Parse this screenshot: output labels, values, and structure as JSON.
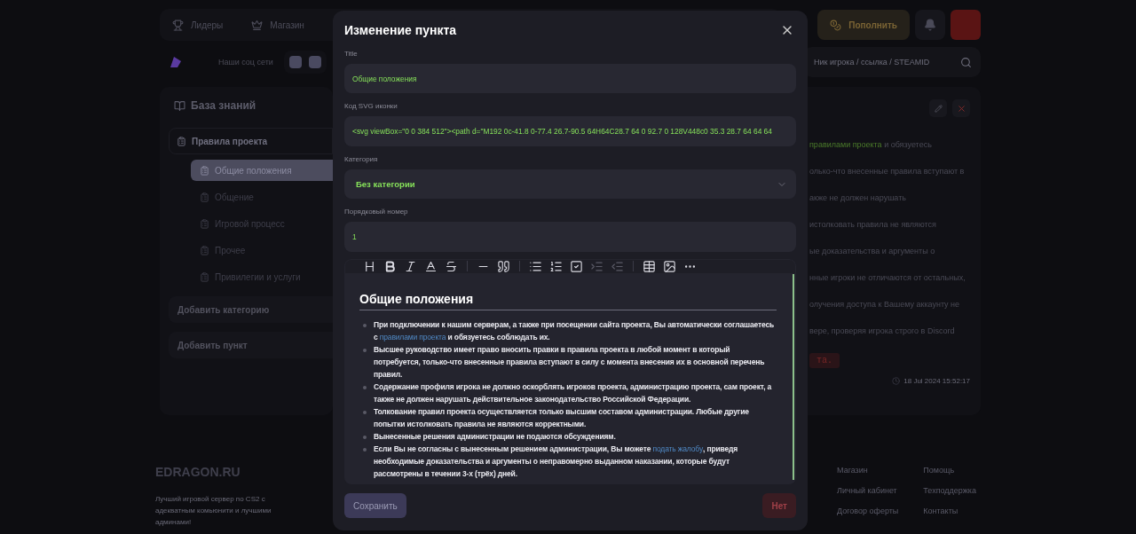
{
  "header": {
    "nav": [
      {
        "label": "Лидеры",
        "kind": "trophy"
      },
      {
        "label": "Магазин",
        "kind": "crown"
      },
      {
        "kind": "gun"
      }
    ],
    "topup": "Пополнить"
  },
  "subheader": {
    "socials_label": "Наши соц сети",
    "search": {
      "placeholder": "Ник игрока / ссылка / STEAMID"
    }
  },
  "sidebar": {
    "title": "База знаний",
    "tree": [
      {
        "label": "Правила проекта",
        "children": [
          {
            "label": "Общие положения",
            "selected": true
          },
          {
            "label": "Общение",
            "selected": false
          },
          {
            "label": "Игровой процесс",
            "selected": false
          },
          {
            "label": "Прочее",
            "selected": false
          },
          {
            "label": "Привилегии и услуги",
            "selected": false
          }
        ]
      }
    ],
    "buttons": [
      "Добавить категорию",
      "Добавить пункт"
    ]
  },
  "article": {
    "lines": [
      [
        {
          "kind": "link",
          "text": "правилами проекта"
        },
        {
          "kind": "text",
          "text": " и обязуетесь"
        }
      ],
      [
        {
          "kind": "text",
          "text": "олько-что внесенные правила вступают в"
        }
      ],
      [
        {
          "kind": "text",
          "text": "акже не должен нарушать"
        }
      ],
      [
        {
          "kind": "text",
          "text": "истолковать правила не являются"
        }
      ],
      [
        {
          "kind": "text",
          "text": "ые доказательства и аргументы о"
        }
      ],
      [
        {
          "kind": "text",
          "text": "нные игроки не отличаются от остальных,"
        }
      ],
      [
        {
          "kind": "text",
          "text": "олучения доступа к Вашему аккаунту не"
        }
      ],
      [
        {
          "kind": "text",
          "text": "вере, проверяя игрока строго в Discord"
        }
      ]
    ],
    "code": "та.",
    "date": "18 Jul 2024 15:52:17"
  },
  "footer": {
    "brand": "EDRAGON.RU",
    "description": "Лучший игровой сервер по CS2 с адекватным комьюнити и лучшими админами!",
    "columns": [
      [
        "Магазин",
        "Личный кабинет",
        "Договор оферты"
      ],
      [
        "Помощь",
        "Техподдержка",
        "Контакты"
      ]
    ]
  },
  "modal": {
    "title": "Изменение пункта",
    "fields": [
      {
        "label": "Title",
        "kind": "input",
        "value": "Общие положения"
      },
      {
        "label": "Код SVG иконки",
        "kind": "input",
        "value": "<svg viewBox=\"0 0 384 512\"><path d=\"M192 0c-41.8 0-77.4 26.7-90.5 64H64C28.7 64 0 92.7 0 128V448c0 35.3 28.7 64 64 64"
      },
      {
        "label": "Категория",
        "kind": "select",
        "value": "Без категории"
      },
      {
        "label": "Порядковый номер",
        "kind": "input",
        "value": "1"
      }
    ],
    "toolbar": [
      {
        "kind": "heading",
        "disabled": false
      },
      {
        "kind": "bold",
        "disabled": false
      },
      {
        "kind": "italic",
        "disabled": false
      },
      {
        "kind": "color",
        "disabled": false
      },
      {
        "kind": "strike",
        "disabled": false
      },
      {
        "kind": "sep"
      },
      {
        "kind": "hr",
        "disabled": false
      },
      {
        "kind": "quote",
        "disabled": false
      },
      {
        "kind": "sep"
      },
      {
        "kind": "ul",
        "disabled": false
      },
      {
        "kind": "ol",
        "disabled": false
      },
      {
        "kind": "task",
        "disabled": false
      },
      {
        "kind": "indent",
        "disabled": true
      },
      {
        "kind": "outdent",
        "disabled": true
      },
      {
        "kind": "sep"
      },
      {
        "kind": "table",
        "disabled": false
      },
      {
        "kind": "image",
        "disabled": false
      },
      {
        "kind": "more",
        "disabled": false
      }
    ],
    "editor": {
      "heading": "Общие положения",
      "items": [
        [
          {
            "kind": "text",
            "text": "При подключении к нашим серверам, а также при посещении сайта проекта, Вы автоматически соглашаетесь с "
          },
          {
            "kind": "link",
            "text": "правилами проекта"
          },
          {
            "kind": "text",
            "text": " и обязуетесь соблюдать их."
          }
        ],
        [
          {
            "kind": "text",
            "text": "Высшее руководство имеет право вносить правки в правила проекта в любой момент в который потребуется, только-что внесенные правила вступают в силу с момента внесения их в основной перечень правил."
          }
        ],
        [
          {
            "kind": "text",
            "text": "Содержание профиля игрока не должно оскорблять игроков проекта, администрацию проекта, сам проект, а также не должен нарушать действительное законодательство Российской Федерации."
          }
        ],
        [
          {
            "kind": "text",
            "text": "Толкование правил проекта осуществляется только высшим составом администрации. Любые другие попытки истолковать правила не являются корректными."
          }
        ],
        [
          {
            "kind": "text",
            "text": "Вынесенные решения администрации не подаются обсуждениям."
          }
        ],
        [
          {
            "kind": "text",
            "text": "Если Вы не согласны с вынесенным решением администрации, Вы можете "
          },
          {
            "kind": "link",
            "text": "подать жалобу"
          },
          {
            "kind": "text",
            "text": ", приведя необходимые доказательства и аргументы о неправомерно выданном наказании, которые будут рассмотрены в течении 3-х (трёх) дней."
          }
        ]
      ]
    },
    "save": "Сохранить",
    "cancel": "Нет"
  }
}
